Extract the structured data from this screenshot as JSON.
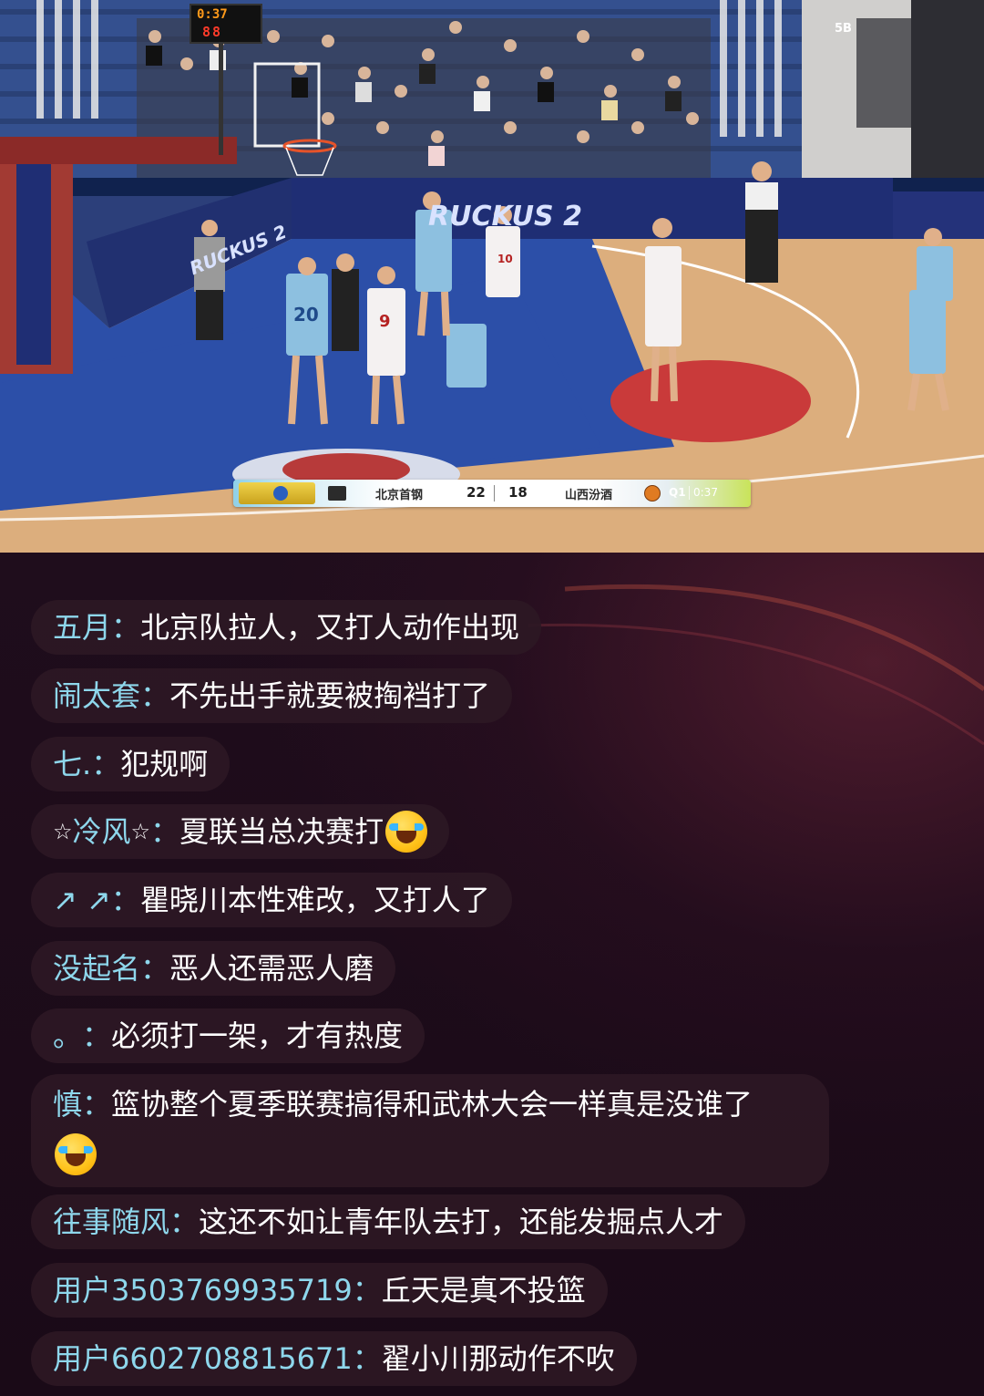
{
  "video": {
    "scoreboard": {
      "home_team": "北京首钢",
      "home_score": "22",
      "away_score": "18",
      "away_team": "山西汾酒",
      "quarter": "Q1",
      "clock": "0:37"
    },
    "shot_clock": {
      "game_time": "0:37",
      "shot": "88"
    },
    "section_sign": "5B",
    "board_text": "RUCKUS 2",
    "side_board_text": "RUCKUS 2",
    "jerseys": [
      "20",
      "9",
      "10"
    ]
  },
  "comments": [
    {
      "user": "五月",
      "text": "北京队拉人，又打人动作出现"
    },
    {
      "user": "闹太套",
      "text": "不先出手就要被掏裆打了"
    },
    {
      "user": "七.",
      "text": "犯规啊"
    },
    {
      "user": "冷风",
      "text": "夏联当总决赛打",
      "emoji": "laughing-crying-emoji"
    },
    {
      "user": "↗ ↗",
      "text": "瞿晓川本性难改，又打人了"
    },
    {
      "user": "没起名",
      "text": "恶人还需恶人磨"
    },
    {
      "user": "。",
      "text": "必须打一架，才有热度"
    },
    {
      "user": "慎",
      "text": "篮协整个夏季联赛搞得和武林大会一样真是没谁了",
      "emoji": "laughing-crying-emoji"
    },
    {
      "user": "往事随风",
      "text": "这还不如让青年队去打，还能发掘点人才"
    },
    {
      "user": "用户3503769935719",
      "text": "丘天是真不投篮"
    },
    {
      "user": "用户6602708815671",
      "text": "翟小川那动作不吹"
    }
  ],
  "colors": {
    "username": "#8ed7ec",
    "message": "#ffffff",
    "bubble": "#2c1824"
  }
}
